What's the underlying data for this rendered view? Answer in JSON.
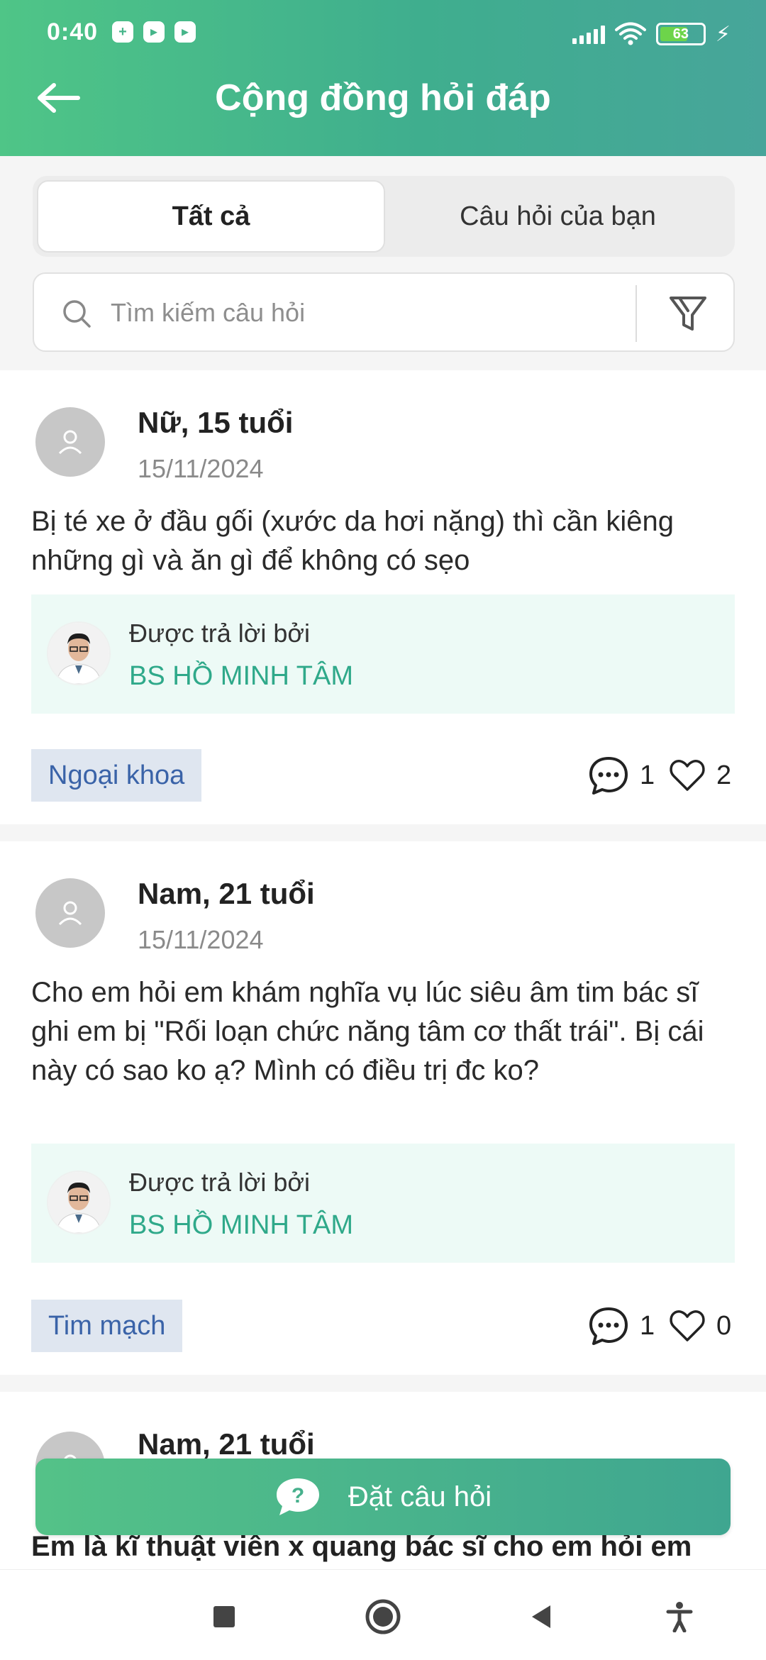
{
  "status_bar": {
    "time": "0:40",
    "notifications": [
      "+",
      "▸",
      "▸"
    ],
    "battery_level": "63",
    "battery_charging": true
  },
  "header": {
    "title": "Cộng đồng hỏi đáp"
  },
  "tabs": [
    {
      "label": "Tất cả",
      "active": true
    },
    {
      "label": "Câu hỏi của bạn",
      "active": false
    }
  ],
  "search": {
    "placeholder": "Tìm kiếm câu hỏi",
    "value": ""
  },
  "posts": [
    {
      "author": "Nữ, 15 tuổi",
      "date": "15/11/2024",
      "question": "Bị té xe ở đầu gối (xước da hơi nặng) thì cần kiêng những gì và ăn gì để không có sẹo",
      "answer_label": "Được trả lời bởi",
      "doctor": "BS HỒ MINH TÂM",
      "tag": "Ngoại khoa",
      "comments": "1",
      "likes": "2"
    },
    {
      "author": "Nam, 21 tuổi",
      "date": "15/11/2024",
      "question": "Cho em hỏi em khám nghĩa vụ lúc siêu âm tim bác sĩ ghi em bị \"Rối loạn chức năng tâm cơ thất trái\". Bị cái này có sao ko ạ? Mình có điều trị đc ko?",
      "answer_label": "Được trả lời bởi",
      "doctor": "BS HỒ MINH TÂM",
      "tag": "Tim mạch",
      "comments": "1",
      "likes": "0"
    },
    {
      "author": "Nam, 21 tuổi",
      "question": "Em là kĩ thuật viên x quang bác sĩ cho em hỏi em"
    }
  ],
  "ask_button": {
    "label": "Đặt câu hỏi"
  },
  "colors": {
    "header_start": "#4fc587",
    "header_end": "#47a59a",
    "accent": "#2fa98a",
    "tag_bg": "#dfe6f0",
    "tag_text": "#3a63a8",
    "answer_bg": "#edfaf6"
  },
  "icons": {
    "back": "arrow-left-icon",
    "search": "search-icon",
    "filter": "filter-icon",
    "comment": "chat-bubble-icon",
    "like": "heart-icon",
    "ask": "question-bubble-icon"
  }
}
